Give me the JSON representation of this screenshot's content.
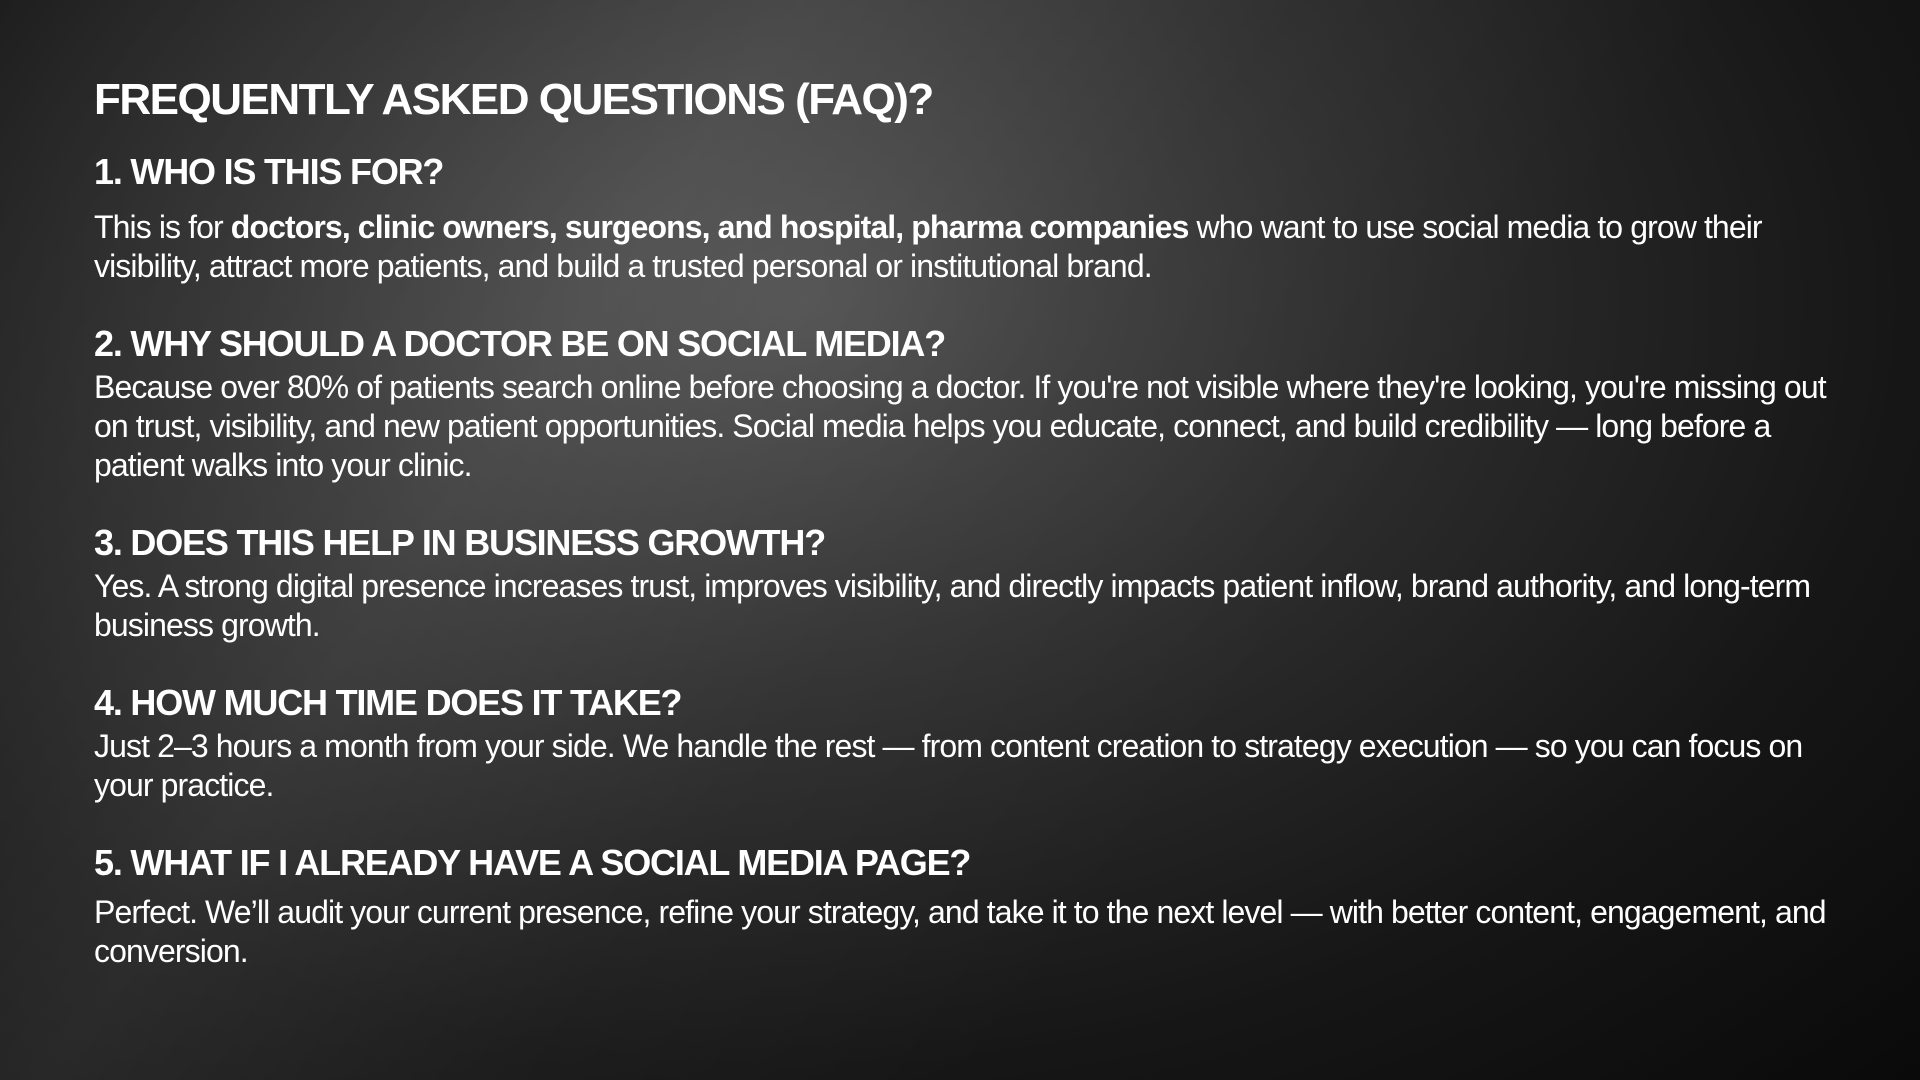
{
  "title": "FREQUENTLY ASKED QUESTIONS (FAQ)?",
  "faqs": [
    {
      "question": "1. WHO IS THIS FOR?",
      "answer_prefix": "This is for ",
      "answer_bold": "doctors, clinic owners, surgeons, and hospital, pharma companies",
      "answer_suffix": " who want to use social media to grow their visibility, attract more patients, and build a trusted personal or institutional brand."
    },
    {
      "question": "2. WHY SHOULD A DOCTOR BE ON SOCIAL MEDIA?",
      "answer": "Because over 80% of patients search online before choosing a doctor. If you're not visible where they're looking, you're missing out on trust, visibility, and new patient opportunities. Social media helps you educate, connect, and build credibility — long before a patient walks into your clinic."
    },
    {
      "question": "3. DOES THIS HELP IN BUSINESS GROWTH?",
      "answer": "Yes. A strong digital presence increases trust, improves visibility, and directly impacts patient inflow, brand authority, and long-term business growth."
    },
    {
      "question": "4. HOW MUCH TIME DOES IT TAKE?",
      "answer": "Just 2–3 hours a month from your side. We handle the rest — from content creation to strategy execution — so you can focus on your practice."
    },
    {
      "question": "5. WHAT IF I ALREADY HAVE A SOCIAL MEDIA PAGE?",
      "answer": "Perfect. We’ll audit your current presence, refine your strategy, and take it to the next level — with better content, engagement, and conversion."
    }
  ]
}
